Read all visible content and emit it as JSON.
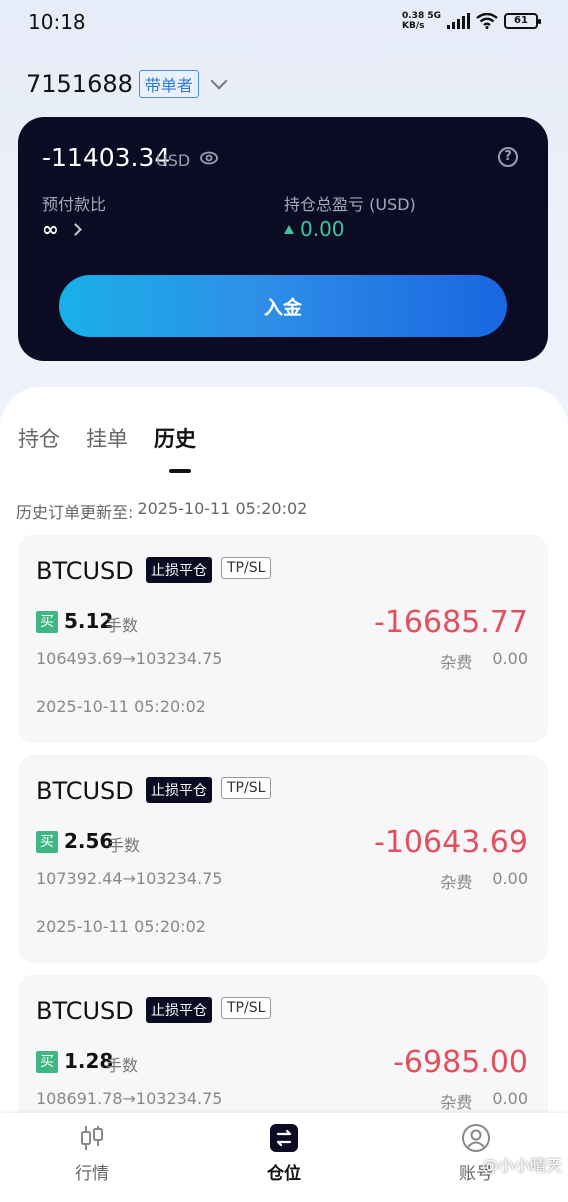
{
  "status_bar": {
    "time": "10:18",
    "net_speed_top": "0.38 5G",
    "net_speed_bottom": "KB/s",
    "battery": "61"
  },
  "account": {
    "id": "7151688",
    "role": "带单者"
  },
  "balance_card": {
    "balance": "-11403.34",
    "unit": "USD",
    "prepay_label": "预付款比",
    "prepay_value": "∞",
    "pnl_label": "持仓总盈亏 (USD)",
    "pnl_value": "0.00",
    "deposit_label": "入金"
  },
  "tabs": [
    "持仓",
    "挂单",
    "历史"
  ],
  "active_tab": "历史",
  "history": {
    "updated_label": "历史订单更新至:",
    "updated_time": "2025-10-11 05:20:02"
  },
  "orders": [
    {
      "symbol": "BTCUSD",
      "close_tag": "止损平仓",
      "tpsl_tag": "TP/SL",
      "side": "买",
      "lots": "5.12",
      "lots_label": "手数",
      "prices": "106493.69→103234.75",
      "pnl": "-16685.77",
      "fee_label": "杂费",
      "fee": "0.00",
      "time": "2025-10-11 05:20:02"
    },
    {
      "symbol": "BTCUSD",
      "close_tag": "止损平仓",
      "tpsl_tag": "TP/SL",
      "side": "买",
      "lots": "2.56",
      "lots_label": "手数",
      "prices": "107392.44→103234.75",
      "pnl": "-10643.69",
      "fee_label": "杂费",
      "fee": "0.00",
      "time": "2025-10-11 05:20:02"
    },
    {
      "symbol": "BTCUSD",
      "close_tag": "止损平仓",
      "tpsl_tag": "TP/SL",
      "side": "买",
      "lots": "1.28",
      "lots_label": "手数",
      "prices": "108691.78→103234.75",
      "pnl": "-6985.00",
      "fee_label": "杂费",
      "fee": "0.00",
      "time": ""
    }
  ],
  "bottom_nav": [
    {
      "label": "行情",
      "icon": "candlestick-icon"
    },
    {
      "label": "仓位",
      "icon": "swap-icon"
    },
    {
      "label": "账号",
      "icon": "user-icon"
    }
  ],
  "watermark": "@小小晴天",
  "colors": {
    "card_bg": "#0b0b24",
    "loss_red": "#e3505c",
    "gain_green": "#3fc59a",
    "buy_green": "#3fb783",
    "accent_blue": "#2f78d8"
  }
}
